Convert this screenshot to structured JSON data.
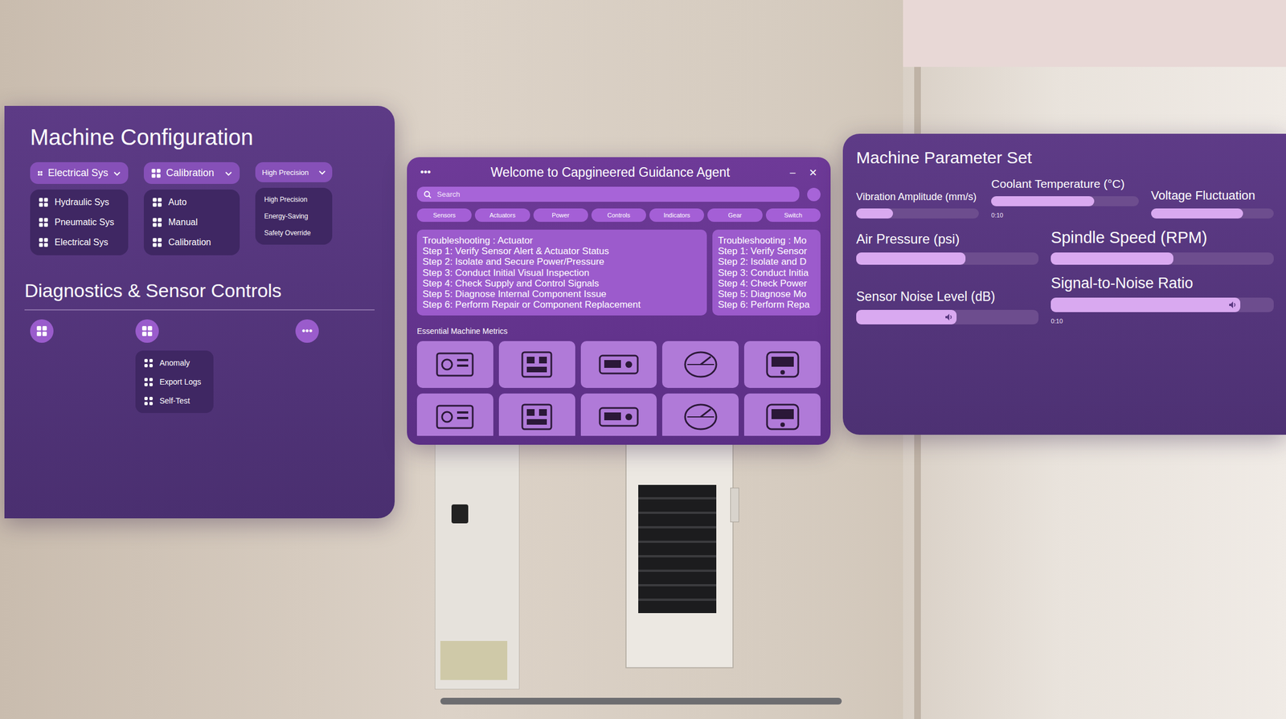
{
  "machine_configuration": {
    "title": "Machine Configuration",
    "groups": [
      {
        "label": "Electrical Sys",
        "expanded": true,
        "items": [
          "Hydraulic Sys",
          "Pneumatic Sys",
          "Electrical Sys"
        ]
      },
      {
        "label": "Calibration",
        "expanded": true,
        "items": [
          "Auto",
          "Manual",
          "Calibration"
        ]
      },
      {
        "label": "High Precision",
        "expanded": true,
        "items": [
          "High Precision",
          "Energy-Saving",
          "Safety Override"
        ]
      }
    ]
  },
  "diagnostics": {
    "title": "Diagnostics & Sensor Controls",
    "buttons": [
      {
        "kind": "icon"
      },
      {
        "kind": "icon"
      },
      {
        "kind": "text",
        "label": "•••"
      }
    ],
    "menu": [
      "Anomaly",
      "Export Logs",
      "Self-Test"
    ]
  },
  "guide": {
    "title": "Welcome to Capgineered Guidance Agent",
    "menu": "•••",
    "minimize": "–",
    "close": "✕",
    "search": {
      "placeholder": "Search"
    },
    "tabs": [
      "Sensors",
      "Actuators",
      "Power",
      "Controls",
      "Indicators",
      "Gear",
      "Switch"
    ],
    "cards": [
      {
        "title": "Troubleshooting : Actuator",
        "steps": [
          "Step 1: Verify Sensor Alert & Actuator Status",
          "Step 2: Isolate and Secure Power/Pressure",
          "Step 3: Conduct Initial Visual Inspection",
          "Step 4: Check Supply and Control Signals",
          "Step 5: Diagnose Internal Component Issue",
          "Step 6: Perform Repair or Component Replacement"
        ]
      },
      {
        "title": "Troubleshooting : Mo",
        "steps": [
          "Step 1: Verify Sensor",
          "Step 2: Isolate and D",
          "Step 3: Conduct Initia",
          "Step 4: Check Power",
          "Step 5: Diagnose Mo",
          "Step 6: Perform Repa"
        ]
      }
    ],
    "metrics_title": "Essential Machine Metrics"
  },
  "parameters": {
    "title": "Machine Parameter Set",
    "rows": [
      [
        {
          "name": "Vibration Amplitude (mm/s)",
          "level": 0.3
        },
        {
          "name": "Coolant Temperature (°C)",
          "level": 0.7,
          "reading": "0:10"
        },
        {
          "name": "Voltage  Fluctuation",
          "level": 0.75
        }
      ],
      [
        {
          "name": "Air Pressure (psi)",
          "level": 0.6
        },
        {
          "name": "Spindle Speed (RPM)",
          "level": 0.55
        }
      ],
      [
        {
          "name": "Sensor Noise Level (dB)",
          "level": 0.55
        },
        {
          "name": "Signal-to-Noise Ratio",
          "level": 0.85,
          "reading": "0:10"
        }
      ]
    ]
  }
}
